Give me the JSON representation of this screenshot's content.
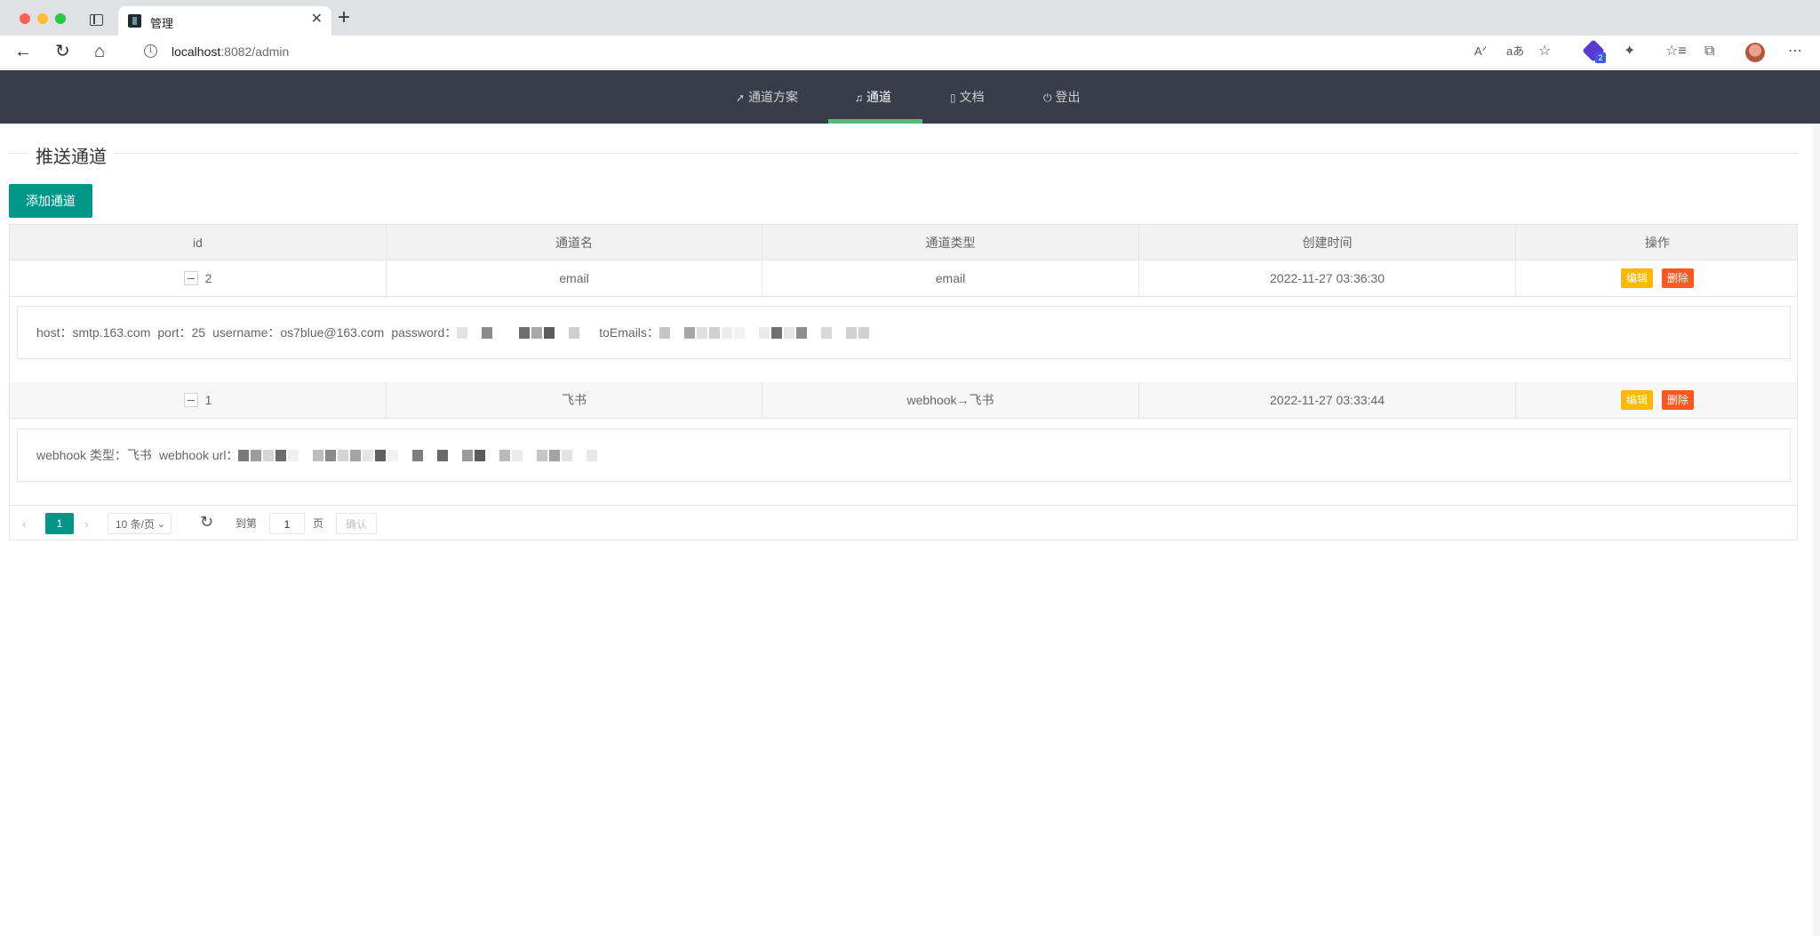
{
  "browser": {
    "tab_title": "管理",
    "url_host": "localhost",
    "url_rest": ":8082/admin",
    "extension_badge": "2"
  },
  "header": {
    "nav": [
      {
        "label": "通道方案",
        "icon": "send-icon"
      },
      {
        "label": "通道",
        "icon": "bell-icon",
        "active": true
      },
      {
        "label": "文档",
        "icon": "file-icon"
      },
      {
        "label": "登出",
        "icon": "power-icon"
      }
    ]
  },
  "page": {
    "title": "推送通道",
    "add_button": "添加通道"
  },
  "table": {
    "columns": [
      "id",
      "通道名",
      "通道类型",
      "创建时间",
      "操作"
    ],
    "rows": [
      {
        "id": "2",
        "name": "email",
        "type": "email",
        "created": "2022-11-27 03:36:30",
        "detail": {
          "host": "host：smtp.163.com",
          "port": "port：25",
          "username": "username：os7blue@163.com",
          "password": "password：",
          "to_emails": "toEmails："
        }
      },
      {
        "id": "1",
        "name": "飞书",
        "type": "webhook→飞书",
        "created": "2022-11-27 03:33:44",
        "detail": {
          "webhook_type": "webhook 类型：飞书",
          "webhook_url": "webhook url："
        }
      }
    ],
    "edit_label": "编辑",
    "delete_label": "删除"
  },
  "pager": {
    "current": "1",
    "limit": "10 条/页",
    "goto_label": "到第",
    "goto_value": "1",
    "page_label": "页",
    "confirm": "确认"
  },
  "colors": {
    "header_bg": "#393d49",
    "primary": "#009688",
    "active_underline": "#5fb878",
    "warm": "#ffb800",
    "danger": "#ff5722"
  }
}
